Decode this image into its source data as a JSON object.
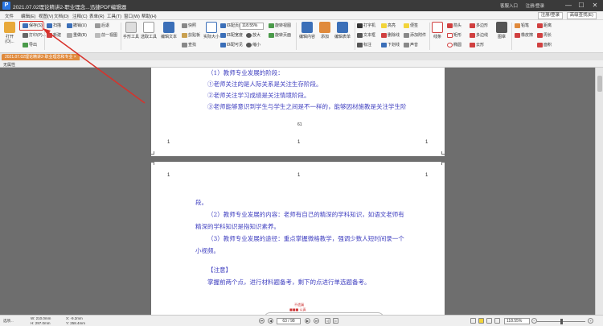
{
  "window": {
    "title": "2021.07.02理论精讲2-职业理念...迅捷PDF编辑器",
    "register": "客服入口",
    "login": "注册/登录",
    "minimize": "—",
    "maximize": "☐",
    "close": "✕"
  },
  "menu": {
    "items": [
      "文件",
      "编辑(E)",
      "视图(V)",
      "文档(D)",
      "注释(C)",
      "表单(R)",
      "工具(T)",
      "窗口(W)",
      "帮助(H)"
    ],
    "right": [
      "注册/登录",
      "高级查找(E)"
    ]
  },
  "ribbon": {
    "open_label": "打开(O)...",
    "save_label": "保存(S)",
    "print_label": "打印(P)...",
    "export_label": "导出",
    "scan_label": "扫描",
    "new_label": "新建",
    "undo_label": "撤销(U)",
    "redo_label": "重做(R)",
    "back_label": "后退",
    "forward_label": "前一视图",
    "hand_label": "手形工具",
    "select_label": "选取工具",
    "edit_label": "编辑文本",
    "edit_tool_label": "编辑工具",
    "snapshot_label": "快照",
    "clipboard_label": "剪贴板",
    "find_label": "查找",
    "actual_size_label": "实际大小",
    "fit_page_label": "匹配页面",
    "fit_width_label": "匹配宽度",
    "fit_visible_label": "匹配可见",
    "zoom_value": "118.55%",
    "zoom_in_label": "放大",
    "zoom_out_label": "缩小",
    "rotate_view_label": "旋转视图",
    "rotate_page_label": "旋转页面",
    "edit_form_label": "编辑内容",
    "add_label": "添加",
    "edit_table_label": "编辑表单",
    "typewriter_label": "打字机",
    "textbox_label": "文本框",
    "callout_label": "标注",
    "highlight_label": "高亮",
    "underline_label": "删除线",
    "strikeout_label": "下划线",
    "note_label": "便签",
    "add_attach_label": "添加附件",
    "sound_label": "声音",
    "line_label": "线条",
    "arrow_label": "箭头",
    "rect_label": "矩形",
    "oval_label": "椭圆",
    "polygon_label": "多边形",
    "polyline_label": "多边线",
    "cloud_label": "云形",
    "stamp_label": "图章",
    "pencil_label": "铅笔",
    "eraser_label": "橡皮擦",
    "distance_label": "距离",
    "perimeter_label": "周长",
    "area_label": "面积"
  },
  "tab": {
    "doc_label": "2021.07.02理论精讲2-职业理念和专业 ×",
    "close": "×"
  },
  "props": {
    "label": "无属性"
  },
  "page1": {
    "line1": "（1）教师专业发展的阶段：",
    "line2": "①老师关注的是人际关系是关注生存阶段。",
    "line3": "②老师关注学习成绩是关注情境阶段。",
    "line4": "③老师能够意识到学生与学生之间是不一样的，能够因材施教是关注学生阶",
    "pagenum": "61",
    "foot_left": "1",
    "foot_mid": "1",
    "foot_right": "1"
  },
  "page2": {
    "head_left": "1",
    "head_mid": "1",
    "head_right": "1",
    "line1": "段。",
    "line2": "（2）教师专业发展的内容：老师有自己的精深的学科知识，如语文老师有",
    "line3": "精深的学科知识是指知识素养。",
    "line4": "（3）教师专业发展的途径：重点掌握微格教学，强调少数人短时间录一个",
    "line5": "小视频。",
    "line6": "【注意】",
    "line7": "掌握前两个点，进行材料题备考，剩下的点进行单选题备考。",
    "tiny1": "不遗漏",
    "tiny2": "■■■ 认真"
  },
  "status": {
    "options_label": "选项...",
    "width": "W: 210.0mm",
    "height": "H: 297.0mm",
    "x": "X: -9.2mm",
    "y": "Y: 258.4mm",
    "page": "63 / 98",
    "zoom": "118.55%"
  },
  "colors": {
    "annotation_red": "#d8322b",
    "doc_text_blue": "#4040c0",
    "tab_orange": "#e08a3c"
  }
}
